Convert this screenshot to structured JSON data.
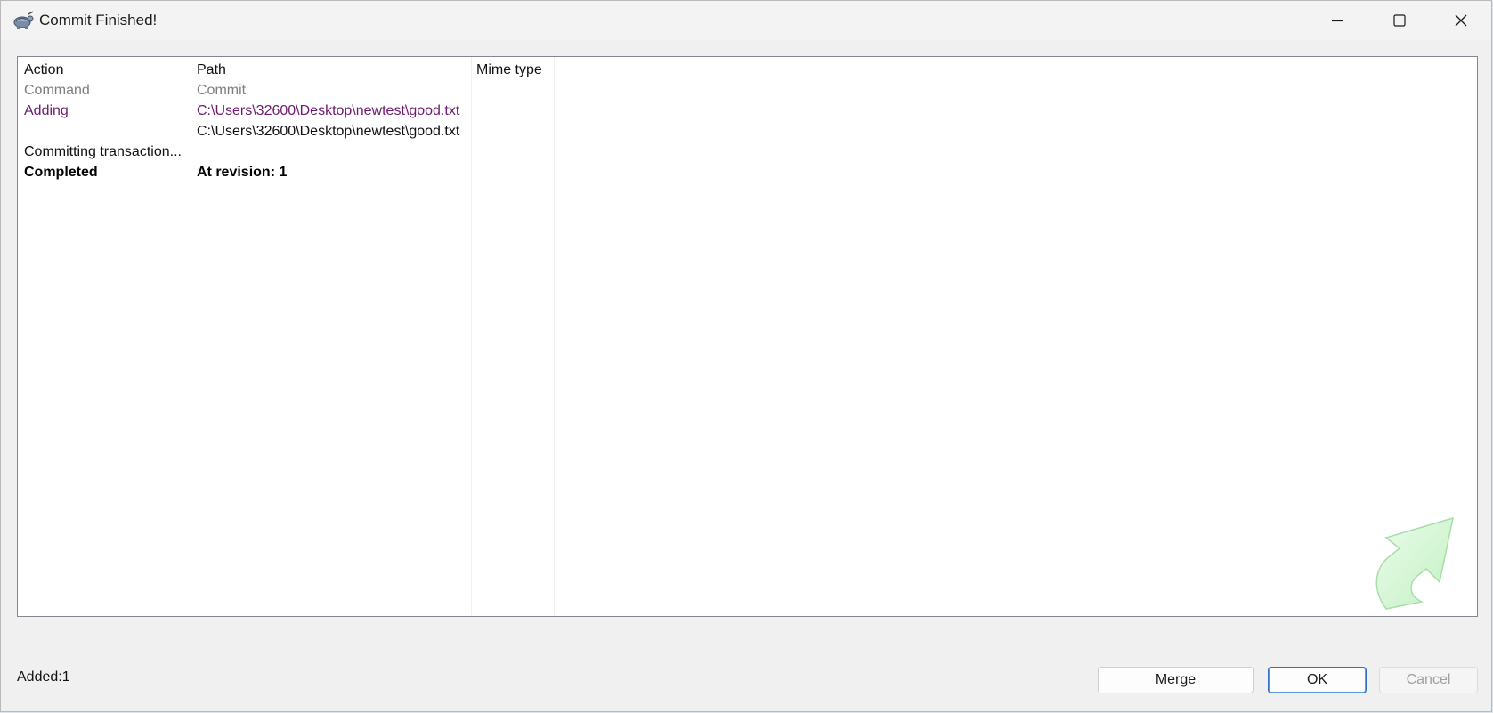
{
  "window": {
    "title": "Commit Finished!"
  },
  "columns": [
    "Action",
    "Path",
    "Mime type"
  ],
  "rows": [
    {
      "action": "Command",
      "path": "Commit",
      "mime": ""
    },
    {
      "action": "Adding",
      "path": "C:\\Users\\32600\\Desktop\\newtest\\good.txt",
      "mime": ""
    },
    {
      "action": "",
      "path": "C:\\Users\\32600\\Desktop\\newtest\\good.txt",
      "mime": ""
    },
    {
      "action": "Committing transaction...",
      "path": "",
      "mime": ""
    },
    {
      "action": "Completed",
      "path": "At revision: 1",
      "mime": ""
    }
  ],
  "status": {
    "text": "Added:1"
  },
  "buttons": {
    "merge": "Merge",
    "ok": "OK",
    "cancel": "Cancel"
  },
  "colors": {
    "command_text": "#7d7d7d",
    "adding_text": "#6e1a6e",
    "watermark_green": "#a8e6a8"
  },
  "icons": {
    "app": "tortoise-icon",
    "minimize": "minimize-icon",
    "maximize": "maximize-icon",
    "close": "close-icon",
    "watermark": "curved-arrow-icon"
  }
}
